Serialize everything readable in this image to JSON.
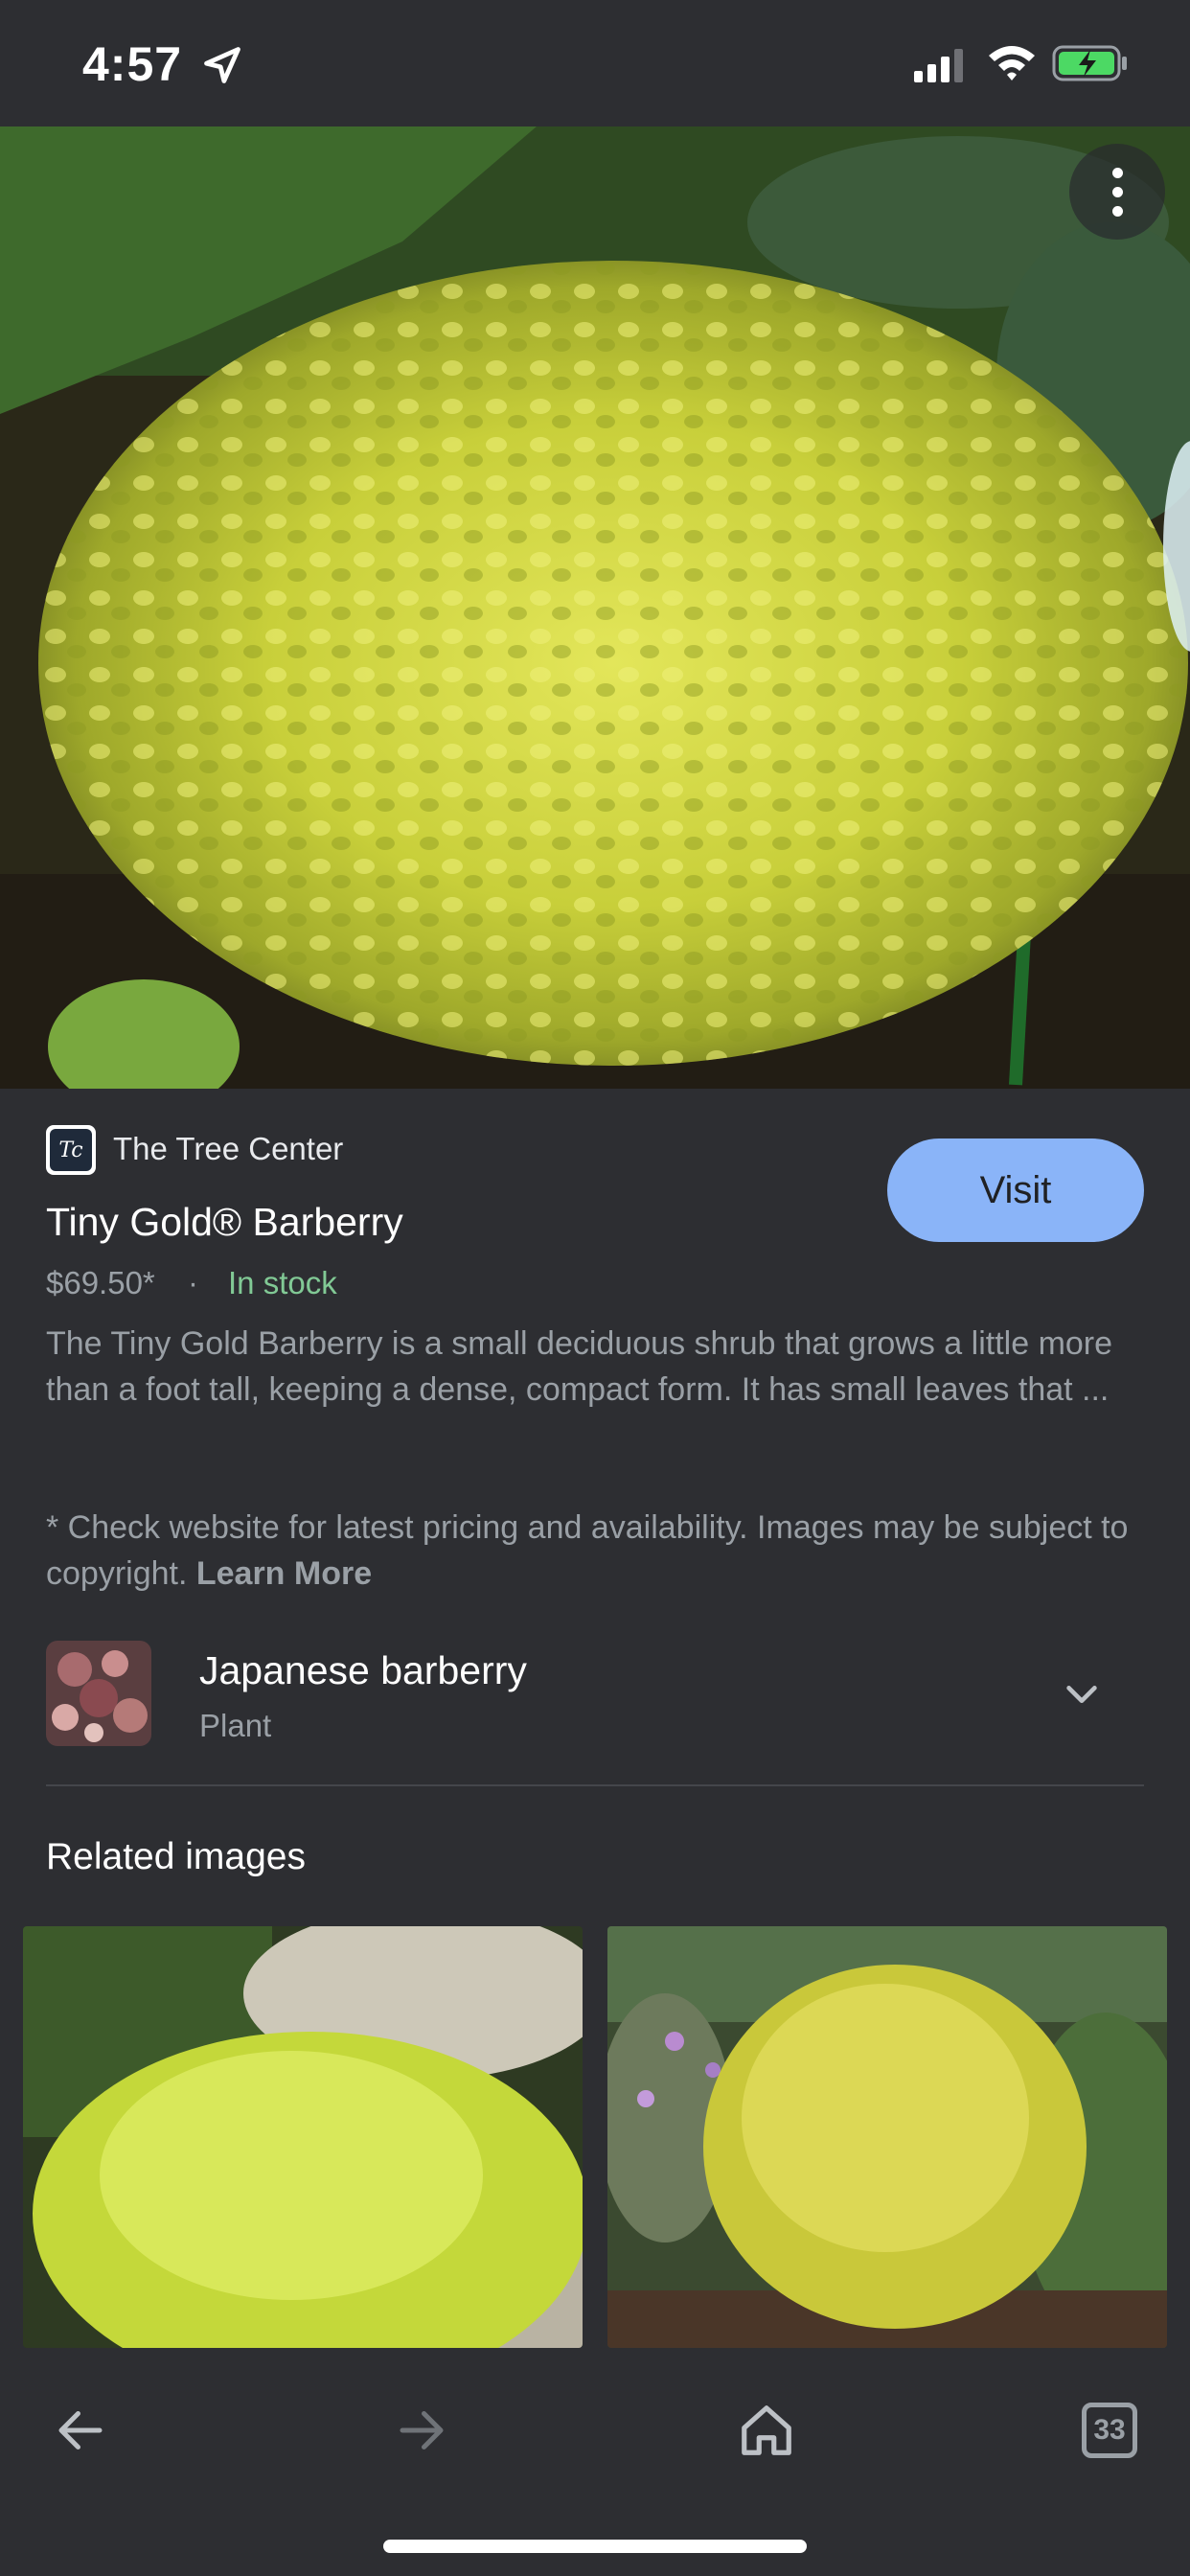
{
  "status_bar": {
    "time": "4:57",
    "icons": [
      "location-arrow-icon",
      "cellular-signal-icon",
      "wifi-icon",
      "battery-charging-icon"
    ]
  },
  "hero": {
    "image": "golden barberry shrub photo",
    "more_icon": "more-vertical-icon"
  },
  "source": {
    "name": "The Tree Center",
    "logo_text": "Tc"
  },
  "visit_label": "Visit",
  "product": {
    "title": "Tiny Gold® Barberry",
    "price": "$69.50*",
    "separator": "·",
    "stock": "In stock",
    "description": "The Tiny Gold Barberry is a small deciduous shrub that grows a little more than a foot tall, keeping a dense, compact form. It has small leaves that ..."
  },
  "disclaimer": {
    "text": "* Check website for latest pricing and availability. Images may be subject to copyright. ",
    "learn_more": "Learn More"
  },
  "entity": {
    "name": "Japanese barberry",
    "type": "Plant",
    "expand_icon": "chevron-down-icon"
  },
  "related": {
    "heading": "Related images"
  },
  "bottom_nav": {
    "back_icon": "arrow-left-icon",
    "forward_icon": "arrow-right-icon",
    "home_icon": "home-icon",
    "tab_count": "33"
  },
  "colors": {
    "background": "#2d2e32",
    "accent": "#8ab4f8",
    "in_stock": "#81c995",
    "muted_text": "#9aa0a6"
  }
}
